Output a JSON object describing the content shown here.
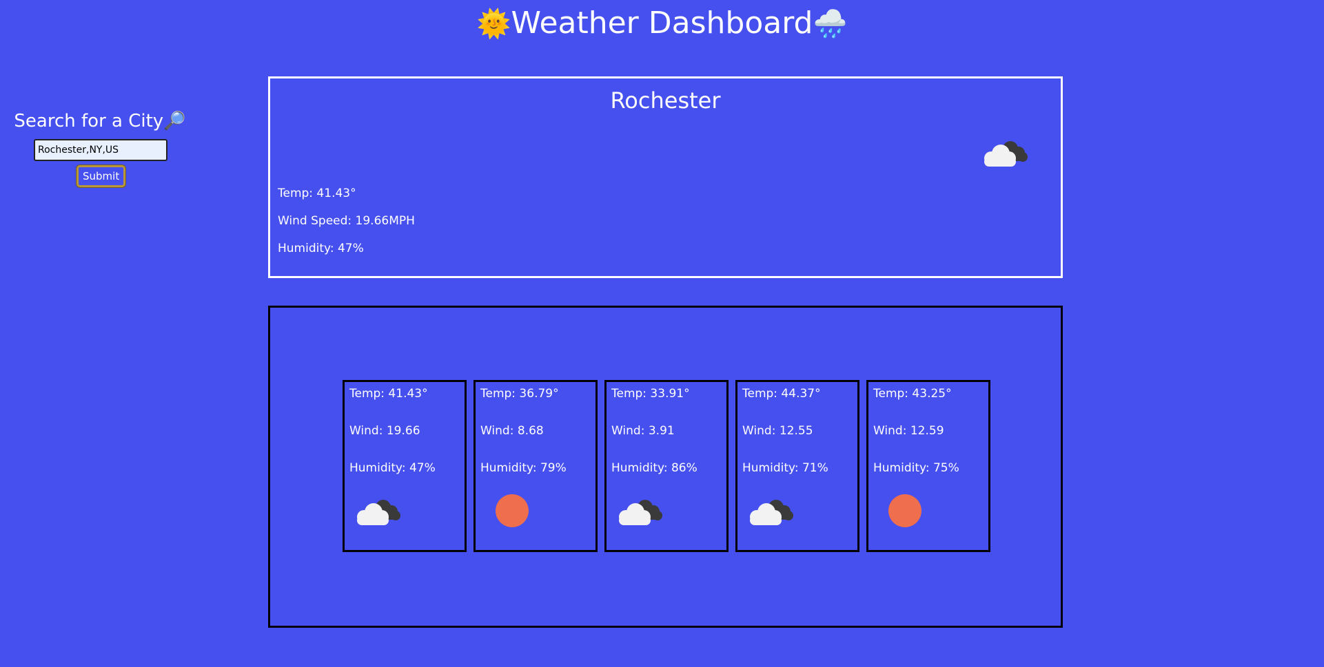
{
  "header": {
    "title": "Weather Dashboard",
    "left_emoji": "🌞",
    "right_emoji": "🌧️"
  },
  "search": {
    "heading": "Search for a City",
    "heading_emoji": "🔎",
    "input_value": "Rochester,NY,US",
    "submit_label": "Submit"
  },
  "current": {
    "city": "Rochester",
    "temp": "Temp: 41.43°",
    "wind": "Wind Speed: 19.66MPH",
    "humidity": "Humidity: 47%",
    "icon": "cloudy-icon"
  },
  "forecast": [
    {
      "temp": "Temp: 41.43°",
      "wind": "Wind: 19.66",
      "humidity": "Humidity: 47%",
      "icon": "cloudy"
    },
    {
      "temp": "Temp: 36.79°",
      "wind": "Wind: 8.68",
      "humidity": "Humidity: 79%",
      "icon": "sun"
    },
    {
      "temp": "Temp: 33.91°",
      "wind": "Wind: 3.91",
      "humidity": "Humidity: 86%",
      "icon": "cloudy"
    },
    {
      "temp": "Temp: 44.37°",
      "wind": "Wind: 12.55",
      "humidity": "Humidity: 71%",
      "icon": "cloudy"
    },
    {
      "temp": "Temp: 43.25°",
      "wind": "Wind: 12.59",
      "humidity": "Humidity: 75%",
      "icon": "sun"
    }
  ],
  "colors": {
    "background": "#4650ee",
    "sun": "#ee6e4e",
    "cloud_front": "#f2f2f2",
    "cloud_back": "#3a3a3a",
    "button_border": "#b8963a"
  }
}
